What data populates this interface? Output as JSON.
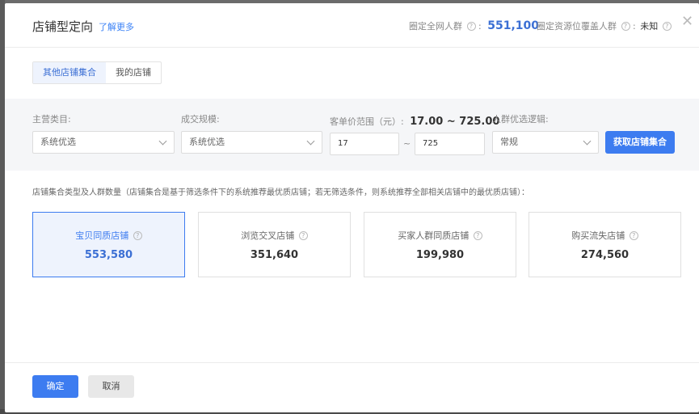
{
  "header": {
    "title": "店铺型定向",
    "learn_more": "了解更多",
    "crowd_label": "圈定全网人群",
    "crowd_value": "551,100",
    "cover_label": "圈定资源位覆盖人群",
    "cover_value": "未知",
    "help_glyph": "?",
    "close_glyph": "✕"
  },
  "tabs": [
    {
      "label": "其他店铺集合",
      "active": true
    },
    {
      "label": "我的店铺",
      "active": false
    }
  ],
  "filters": {
    "category_label": "主营类目:",
    "category_value": "系统优选",
    "scale_label": "成交规模:",
    "scale_value": "系统优选",
    "price_label": "客单价范围（元）:",
    "price_range": "17.00 ~ 725.00",
    "price_min": "17",
    "price_max": "725",
    "price_sep": "~",
    "logic_label": "人群优选逻辑:",
    "logic_value": "常规",
    "fetch_button": "获取店铺集合"
  },
  "description": "店铺集合类型及人群数量（店铺集合是基于筛选条件下的系统推荐最优质店铺；若无筛选条件，则系统推荐全部相关店铺中的最优质店铺）：",
  "cards": [
    {
      "name": "宝贝同质店铺",
      "value": "553,580",
      "selected": true
    },
    {
      "name": "浏览交叉店铺",
      "value": "351,640",
      "selected": false
    },
    {
      "name": "买家人群同质店铺",
      "value": "199,980",
      "selected": false
    },
    {
      "name": "购买流失店铺",
      "value": "274,560",
      "selected": false
    }
  ],
  "footer": {
    "confirm": "确定",
    "cancel": "取消"
  },
  "colors": {
    "accent": "#3d7cf0",
    "selected_bg": "#eef3fd"
  }
}
